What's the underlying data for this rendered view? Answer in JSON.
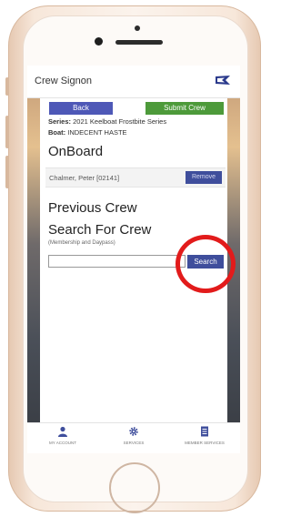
{
  "app": {
    "title": "Crew Signon",
    "accent": "#4e58b7",
    "submit_color": "#4d9a3a",
    "highlight_color": "#e21b1b"
  },
  "toolbar": {
    "back_label": "Back",
    "submit_label": "Submit Crew"
  },
  "info": {
    "series_label": "Series:",
    "series_value": "2021 Keelboat Frostbite Series",
    "boat_label": "Boat:",
    "boat_value": "INDECENT HASTE"
  },
  "onboard": {
    "heading": "OnBoard",
    "crew": [
      {
        "name": "Chalmer, Peter [02141]",
        "remove_label": "Remove"
      }
    ]
  },
  "previous_crew": {
    "heading": "Previous Crew"
  },
  "search": {
    "heading": "Search For Crew",
    "hint": "(Membership and Daypass)",
    "value": "",
    "placeholder": "",
    "button_label": "Search"
  },
  "bottom_nav": [
    {
      "label": "MY ACCOUNT",
      "icon": "person-icon"
    },
    {
      "label": "SERVICES",
      "icon": "gear-icon"
    },
    {
      "label": "MEMBER SERVICES",
      "icon": "document-icon"
    }
  ]
}
